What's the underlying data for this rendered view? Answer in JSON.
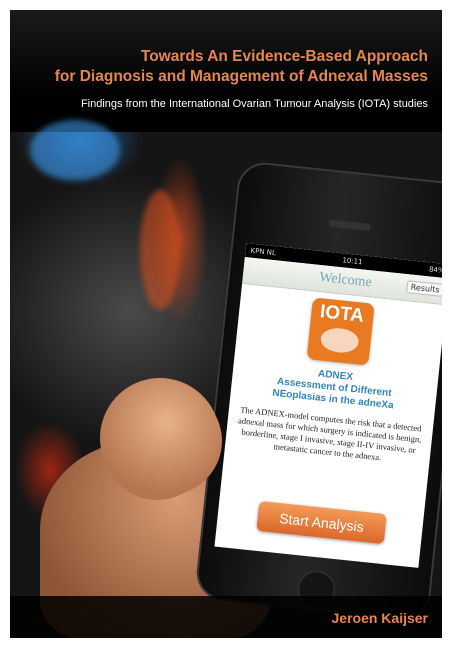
{
  "cover": {
    "title_line1": "Towards An Evidence-Based Approach",
    "title_line2": "for Diagnosis and Management of Adnexal Masses",
    "subtitle": "Findings from the International Ovarian Tumour Analysis (IOTA) studies",
    "author": "Jeroen Kaijser"
  },
  "phone": {
    "carrier": "KPN NL",
    "time": "10:11",
    "battery": "84%",
    "welcome": "Welcome",
    "results_label": "Results",
    "logo_text": "IOTA",
    "app_title": "ADNEX",
    "app_subtitle_line1": "Assessment of Different",
    "app_subtitle_line2": "NEoplasias in the adneXa",
    "app_description": "The ADNEX-model computes the risk that a detected adnexal mass for which surgery is indicated is benign, borderline, stage I invasive, stage II-IV invasive, or metastatic cancer to the adnexa.",
    "start_button": "Start Analysis"
  },
  "colors": {
    "title_orange": "#e48654",
    "logo_orange": "#e97a22",
    "app_blue": "#2f86b8",
    "welcome_teal": "#77a8b8"
  }
}
